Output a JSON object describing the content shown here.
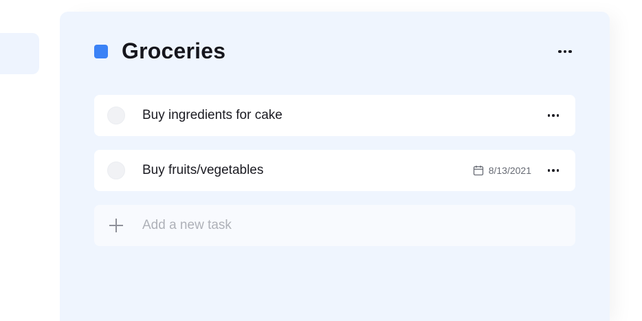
{
  "list": {
    "title": "Groceries",
    "color": "#3b82f6"
  },
  "tasks": [
    {
      "label": "Buy ingredients for cake",
      "due": ""
    },
    {
      "label": "Buy fruits/vegetables",
      "due": "8/13/2021"
    }
  ],
  "add_task": {
    "placeholder": "Add a new task"
  },
  "icons": {
    "list_color": "color-swatch-icon",
    "more": "more-horizontal-icon",
    "checkbox": "circle-checkbox-icon",
    "due_date": "calendar-icon",
    "add": "plus-icon"
  }
}
